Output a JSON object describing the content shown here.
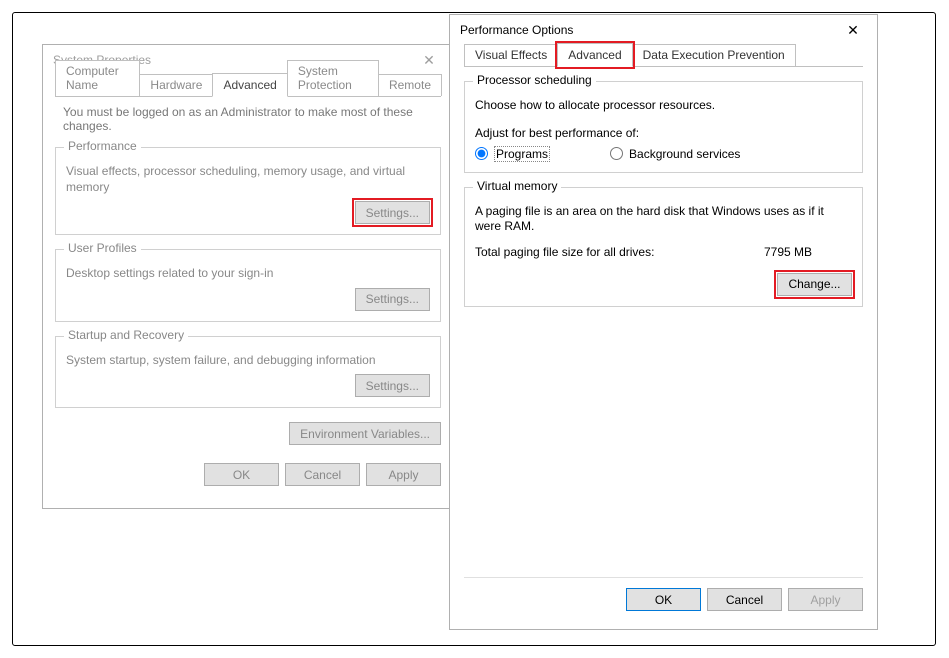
{
  "sysprops": {
    "title": "System Properties",
    "tabs": [
      "Computer Name",
      "Hardware",
      "Advanced",
      "System Protection",
      "Remote"
    ],
    "active_tab": "Advanced",
    "note": "You must be logged on as an Administrator to make most of these changes.",
    "performance": {
      "title": "Performance",
      "desc": "Visual effects, processor scheduling, memory usage, and virtual memory",
      "settings_btn": "Settings..."
    },
    "user_profiles": {
      "title": "User Profiles",
      "desc": "Desktop settings related to your sign-in",
      "settings_btn": "Settings..."
    },
    "startup": {
      "title": "Startup and Recovery",
      "desc": "System startup, system failure, and debugging information",
      "settings_btn": "Settings..."
    },
    "env_btn": "Environment Variables...",
    "ok": "OK",
    "cancel": "Cancel",
    "apply": "Apply"
  },
  "perfopts": {
    "title": "Performance Options",
    "tabs": [
      "Visual Effects",
      "Advanced",
      "Data Execution Prevention"
    ],
    "active_tab": "Advanced",
    "processor": {
      "title": "Processor scheduling",
      "desc": "Choose how to allocate processor resources.",
      "label": "Adjust for best performance of:",
      "opt_programs": "Programs",
      "opt_services": "Background services"
    },
    "vm": {
      "title": "Virtual memory",
      "desc": "A paging file is an area on the hard disk that Windows uses as if it were RAM.",
      "total_label": "Total paging file size for all drives:",
      "total_value": "7795 MB",
      "change_btn": "Change..."
    },
    "ok": "OK",
    "cancel": "Cancel",
    "apply": "Apply"
  },
  "colors": {
    "highlight": "#e31b23",
    "accent": "#0078d7"
  }
}
